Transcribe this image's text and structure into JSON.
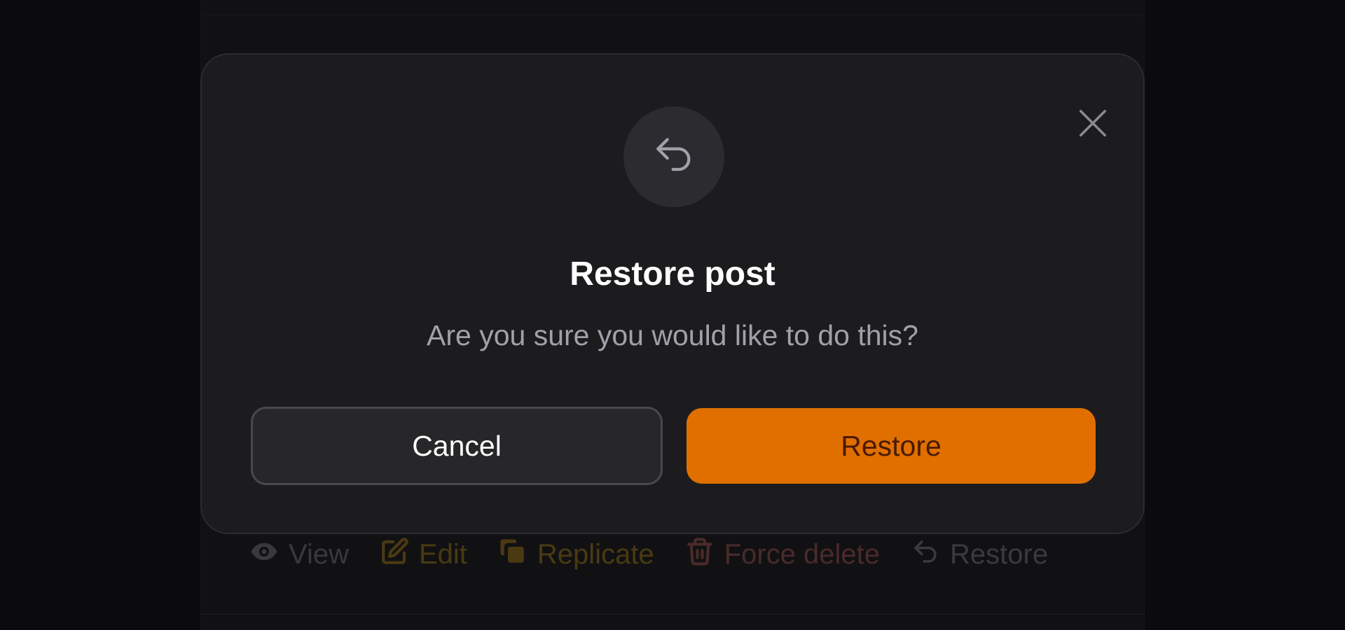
{
  "background": {
    "actions": [
      {
        "label": "View",
        "icon": "eye-icon"
      },
      {
        "label": "Edit",
        "icon": "pencil-square-icon"
      },
      {
        "label": "Replicate",
        "icon": "copy-icon"
      },
      {
        "label": "Force delete",
        "icon": "trash-icon"
      },
      {
        "label": "Restore",
        "icon": "undo-arrow-icon"
      }
    ]
  },
  "modal": {
    "title": "Restore post",
    "description": "Are you sure you would like to do this?",
    "icon": "undo-arrow-icon",
    "close_icon": "close-icon",
    "cancel_label": "Cancel",
    "confirm_label": "Restore"
  },
  "colors": {
    "accent": "#e06f00",
    "modal_bg": "#1c1c1f",
    "page_bg": "#0b0b0d"
  }
}
